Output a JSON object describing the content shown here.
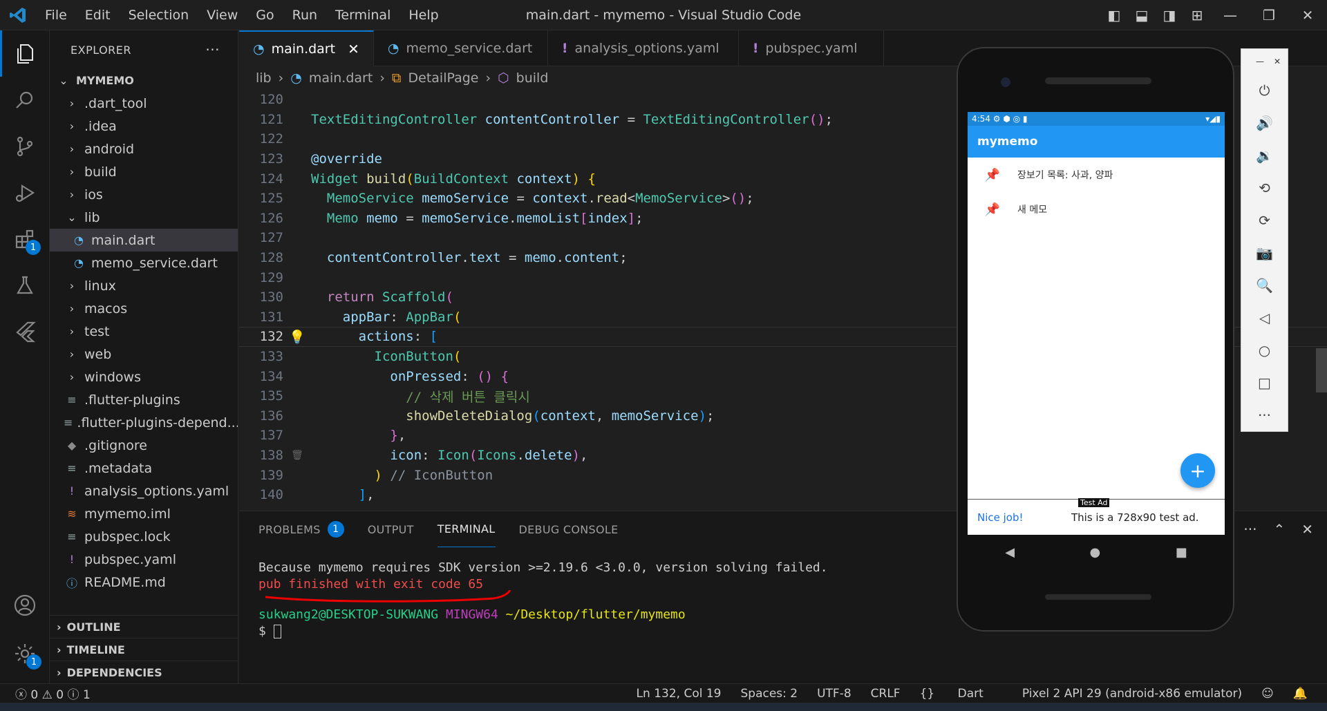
{
  "window": {
    "title": "main.dart - mymemo - Visual Studio Code"
  },
  "menu": [
    "File",
    "Edit",
    "Selection",
    "View",
    "Go",
    "Run",
    "Terminal",
    "Help"
  ],
  "activity": {
    "extensions_badge": "1",
    "settings_badge": "1"
  },
  "explorer": {
    "title": "EXPLORER",
    "root": "MYMEMO",
    "items": [
      {
        "label": ".dart_tool",
        "type": "folder"
      },
      {
        "label": ".idea",
        "type": "folder"
      },
      {
        "label": "android",
        "type": "folder"
      },
      {
        "label": "build",
        "type": "folder"
      },
      {
        "label": "ios",
        "type": "folder"
      },
      {
        "label": "lib",
        "type": "folder-open"
      },
      {
        "label": "main.dart",
        "type": "dart",
        "selected": true
      },
      {
        "label": "memo_service.dart",
        "type": "dart"
      },
      {
        "label": "linux",
        "type": "folder"
      },
      {
        "label": "macos",
        "type": "folder"
      },
      {
        "label": "test",
        "type": "folder"
      },
      {
        "label": "web",
        "type": "folder"
      },
      {
        "label": "windows",
        "type": "folder"
      },
      {
        "label": ".flutter-plugins",
        "type": "lines"
      },
      {
        "label": ".flutter-plugins-depend...",
        "type": "lines"
      },
      {
        "label": ".gitignore",
        "type": "git"
      },
      {
        "label": ".metadata",
        "type": "lines"
      },
      {
        "label": "analysis_options.yaml",
        "type": "yaml"
      },
      {
        "label": "mymemo.iml",
        "type": "rss"
      },
      {
        "label": "pubspec.lock",
        "type": "lines"
      },
      {
        "label": "pubspec.yaml",
        "type": "yaml"
      },
      {
        "label": "README.md",
        "type": "info"
      }
    ],
    "sections": [
      "OUTLINE",
      "TIMELINE",
      "DEPENDENCIES"
    ]
  },
  "tabs": [
    {
      "label": "main.dart",
      "active": true
    },
    {
      "label": "memo_service.dart"
    },
    {
      "label": "analysis_options.yaml"
    },
    {
      "label": "pubspec.yaml"
    }
  ],
  "breadcrumb": [
    "lib",
    "main.dart",
    "DetailPage",
    "build"
  ],
  "code": {
    "lines": [
      "120",
      "121",
      "122",
      "123",
      "124",
      "125",
      "126",
      "127",
      "128",
      "129",
      "130",
      "131",
      "132",
      "133",
      "134",
      "135",
      "136",
      "137",
      "138",
      "139",
      "140"
    ],
    "current": "132",
    "comment_korean": "// 삭제 버튼 클릭시",
    "comment_iconbutton": "// IconButton"
  },
  "panel": {
    "tabs": [
      "PROBLEMS",
      "OUTPUT",
      "TERMINAL",
      "DEBUG CONSOLE"
    ],
    "problems_count": "1",
    "terminal": {
      "line1": "Because mymemo requires SDK version >=2.19.6 <3.0.0, version solving failed.",
      "line2": "pub finished with exit code 65",
      "prompt_user": "sukwang2@DESKTOP-SUKWANG",
      "prompt_env": "MINGW64",
      "prompt_path": "~/Desktop/flutter/mymemo",
      "prompt_char": "$"
    }
  },
  "statusbar": {
    "errors": "0",
    "warnings": "0",
    "infos": "1",
    "position": "Ln 132, Col 19",
    "spaces": "Spaces: 2",
    "encoding": "UTF-8",
    "eol": "CRLF",
    "language": "Dart",
    "device": "Pixel 2 API 29 (android-x86 emulator)"
  },
  "emulator": {
    "time": "4:54",
    "app_title": "mymemo",
    "memos": [
      "장보기 목록: 사과, 양파",
      "새 메모"
    ],
    "ad_label": "Test Ad",
    "ad_link": "Nice job!",
    "ad_text": "This is a 728x90 test ad."
  },
  "colors": {
    "accent": "#0078d4",
    "flutter_blue": "#2196f3",
    "error": "#f14c4c"
  }
}
